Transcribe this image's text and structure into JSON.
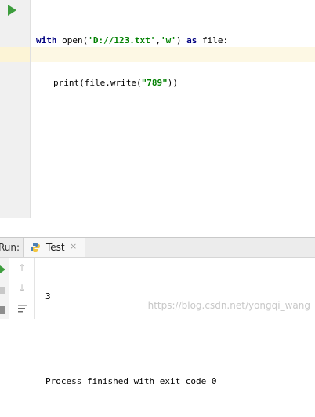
{
  "editor": {
    "code_line1": {
      "kw_with": "with",
      "call": "open(",
      "arg1": "'D://123.txt'",
      "comma": ",",
      "arg2": "'w'",
      "close": ") ",
      "kw_as": "as",
      "rest": " file:"
    },
    "code_line2": {
      "prefix": "print(file.write(",
      "arg": "\"789\"",
      "suffix": "))"
    }
  },
  "run_window": {
    "label": "Run:",
    "tab_label": "Test",
    "tab_close": "×",
    "up_arrow": "↑",
    "down_arrow": "↓",
    "output_lines": [
      "3",
      "",
      "Process finished with exit code 0"
    ]
  },
  "watermark": "https://blog.csdn.net/yongqi_wang",
  "colors": {
    "keyword": "#000080",
    "string": "#008000",
    "caret_line": "#fdf8e4",
    "run_green": "#3d9d3d"
  },
  "icons": {
    "run": "run-arrow-icon",
    "python": "python-icon",
    "close": "close-icon",
    "rerun": "rerun-icon",
    "stop": "stop-icon",
    "up": "scroll-up-icon",
    "down": "scroll-down-icon",
    "wrap": "soft-wrap-icon"
  }
}
